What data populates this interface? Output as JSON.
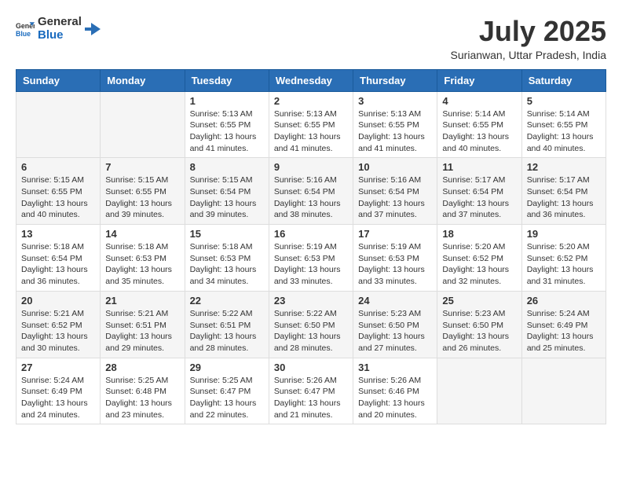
{
  "header": {
    "logo_general": "General",
    "logo_blue": "Blue",
    "month_title": "July 2025",
    "location": "Surianwan, Uttar Pradesh, India"
  },
  "weekdays": [
    "Sunday",
    "Monday",
    "Tuesday",
    "Wednesday",
    "Thursday",
    "Friday",
    "Saturday"
  ],
  "weeks": [
    [
      {
        "day": "",
        "sunrise": "",
        "sunset": "",
        "daylight": ""
      },
      {
        "day": "",
        "sunrise": "",
        "sunset": "",
        "daylight": ""
      },
      {
        "day": "1",
        "sunrise": "Sunrise: 5:13 AM",
        "sunset": "Sunset: 6:55 PM",
        "daylight": "Daylight: 13 hours and 41 minutes."
      },
      {
        "day": "2",
        "sunrise": "Sunrise: 5:13 AM",
        "sunset": "Sunset: 6:55 PM",
        "daylight": "Daylight: 13 hours and 41 minutes."
      },
      {
        "day": "3",
        "sunrise": "Sunrise: 5:13 AM",
        "sunset": "Sunset: 6:55 PM",
        "daylight": "Daylight: 13 hours and 41 minutes."
      },
      {
        "day": "4",
        "sunrise": "Sunrise: 5:14 AM",
        "sunset": "Sunset: 6:55 PM",
        "daylight": "Daylight: 13 hours and 40 minutes."
      },
      {
        "day": "5",
        "sunrise": "Sunrise: 5:14 AM",
        "sunset": "Sunset: 6:55 PM",
        "daylight": "Daylight: 13 hours and 40 minutes."
      }
    ],
    [
      {
        "day": "6",
        "sunrise": "Sunrise: 5:15 AM",
        "sunset": "Sunset: 6:55 PM",
        "daylight": "Daylight: 13 hours and 40 minutes."
      },
      {
        "day": "7",
        "sunrise": "Sunrise: 5:15 AM",
        "sunset": "Sunset: 6:55 PM",
        "daylight": "Daylight: 13 hours and 39 minutes."
      },
      {
        "day": "8",
        "sunrise": "Sunrise: 5:15 AM",
        "sunset": "Sunset: 6:54 PM",
        "daylight": "Daylight: 13 hours and 39 minutes."
      },
      {
        "day": "9",
        "sunrise": "Sunrise: 5:16 AM",
        "sunset": "Sunset: 6:54 PM",
        "daylight": "Daylight: 13 hours and 38 minutes."
      },
      {
        "day": "10",
        "sunrise": "Sunrise: 5:16 AM",
        "sunset": "Sunset: 6:54 PM",
        "daylight": "Daylight: 13 hours and 37 minutes."
      },
      {
        "day": "11",
        "sunrise": "Sunrise: 5:17 AM",
        "sunset": "Sunset: 6:54 PM",
        "daylight": "Daylight: 13 hours and 37 minutes."
      },
      {
        "day": "12",
        "sunrise": "Sunrise: 5:17 AM",
        "sunset": "Sunset: 6:54 PM",
        "daylight": "Daylight: 13 hours and 36 minutes."
      }
    ],
    [
      {
        "day": "13",
        "sunrise": "Sunrise: 5:18 AM",
        "sunset": "Sunset: 6:54 PM",
        "daylight": "Daylight: 13 hours and 36 minutes."
      },
      {
        "day": "14",
        "sunrise": "Sunrise: 5:18 AM",
        "sunset": "Sunset: 6:53 PM",
        "daylight": "Daylight: 13 hours and 35 minutes."
      },
      {
        "day": "15",
        "sunrise": "Sunrise: 5:18 AM",
        "sunset": "Sunset: 6:53 PM",
        "daylight": "Daylight: 13 hours and 34 minutes."
      },
      {
        "day": "16",
        "sunrise": "Sunrise: 5:19 AM",
        "sunset": "Sunset: 6:53 PM",
        "daylight": "Daylight: 13 hours and 33 minutes."
      },
      {
        "day": "17",
        "sunrise": "Sunrise: 5:19 AM",
        "sunset": "Sunset: 6:53 PM",
        "daylight": "Daylight: 13 hours and 33 minutes."
      },
      {
        "day": "18",
        "sunrise": "Sunrise: 5:20 AM",
        "sunset": "Sunset: 6:52 PM",
        "daylight": "Daylight: 13 hours and 32 minutes."
      },
      {
        "day": "19",
        "sunrise": "Sunrise: 5:20 AM",
        "sunset": "Sunset: 6:52 PM",
        "daylight": "Daylight: 13 hours and 31 minutes."
      }
    ],
    [
      {
        "day": "20",
        "sunrise": "Sunrise: 5:21 AM",
        "sunset": "Sunset: 6:52 PM",
        "daylight": "Daylight: 13 hours and 30 minutes."
      },
      {
        "day": "21",
        "sunrise": "Sunrise: 5:21 AM",
        "sunset": "Sunset: 6:51 PM",
        "daylight": "Daylight: 13 hours and 29 minutes."
      },
      {
        "day": "22",
        "sunrise": "Sunrise: 5:22 AM",
        "sunset": "Sunset: 6:51 PM",
        "daylight": "Daylight: 13 hours and 28 minutes."
      },
      {
        "day": "23",
        "sunrise": "Sunrise: 5:22 AM",
        "sunset": "Sunset: 6:50 PM",
        "daylight": "Daylight: 13 hours and 28 minutes."
      },
      {
        "day": "24",
        "sunrise": "Sunrise: 5:23 AM",
        "sunset": "Sunset: 6:50 PM",
        "daylight": "Daylight: 13 hours and 27 minutes."
      },
      {
        "day": "25",
        "sunrise": "Sunrise: 5:23 AM",
        "sunset": "Sunset: 6:50 PM",
        "daylight": "Daylight: 13 hours and 26 minutes."
      },
      {
        "day": "26",
        "sunrise": "Sunrise: 5:24 AM",
        "sunset": "Sunset: 6:49 PM",
        "daylight": "Daylight: 13 hours and 25 minutes."
      }
    ],
    [
      {
        "day": "27",
        "sunrise": "Sunrise: 5:24 AM",
        "sunset": "Sunset: 6:49 PM",
        "daylight": "Daylight: 13 hours and 24 minutes."
      },
      {
        "day": "28",
        "sunrise": "Sunrise: 5:25 AM",
        "sunset": "Sunset: 6:48 PM",
        "daylight": "Daylight: 13 hours and 23 minutes."
      },
      {
        "day": "29",
        "sunrise": "Sunrise: 5:25 AM",
        "sunset": "Sunset: 6:47 PM",
        "daylight": "Daylight: 13 hours and 22 minutes."
      },
      {
        "day": "30",
        "sunrise": "Sunrise: 5:26 AM",
        "sunset": "Sunset: 6:47 PM",
        "daylight": "Daylight: 13 hours and 21 minutes."
      },
      {
        "day": "31",
        "sunrise": "Sunrise: 5:26 AM",
        "sunset": "Sunset: 6:46 PM",
        "daylight": "Daylight: 13 hours and 20 minutes."
      },
      {
        "day": "",
        "sunrise": "",
        "sunset": "",
        "daylight": ""
      },
      {
        "day": "",
        "sunrise": "",
        "sunset": "",
        "daylight": ""
      }
    ]
  ]
}
